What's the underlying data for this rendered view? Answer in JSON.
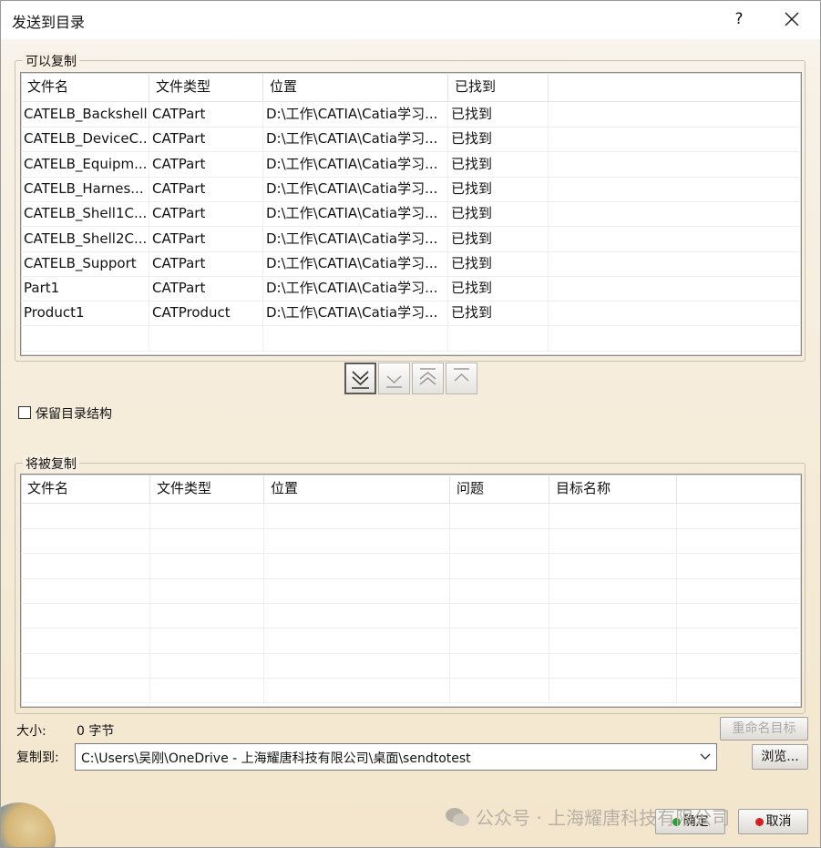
{
  "window": {
    "title": "发送到目录",
    "help_label": "?"
  },
  "copyable": {
    "label": "可以复制",
    "columns": [
      "文件名",
      "文件类型",
      "位置",
      "已找到"
    ],
    "rows": [
      [
        "CATELB_Backshell",
        "CATPart",
        "D:\\工作\\CATIA\\Catia学习...",
        "已找到"
      ],
      [
        "CATELB_DeviceC...",
        "CATPart",
        "D:\\工作\\CATIA\\Catia学习...",
        "已找到"
      ],
      [
        "CATELB_Equipm...",
        "CATPart",
        "D:\\工作\\CATIA\\Catia学习...",
        "已找到"
      ],
      [
        "CATELB_Harnes...",
        "CATPart",
        "D:\\工作\\CATIA\\Catia学习...",
        "已找到"
      ],
      [
        "CATELB_Shell1C...",
        "CATPart",
        "D:\\工作\\CATIA\\Catia学习...",
        "已找到"
      ],
      [
        "CATELB_Shell2C...",
        "CATPart",
        "D:\\工作\\CATIA\\Catia学习...",
        "已找到"
      ],
      [
        "CATELB_Support",
        "CATPart",
        "D:\\工作\\CATIA\\Catia学习...",
        "已找到"
      ],
      [
        "Part1",
        "CATPart",
        "D:\\工作\\CATIA\\Catia学习...",
        "已找到"
      ],
      [
        "Product1",
        "CATProduct",
        "D:\\工作\\CATIA\\Catia学习...",
        "已找到"
      ]
    ]
  },
  "move_buttons": [
    {
      "name": "move-all-down",
      "icon": "double-chevron-down-icon"
    },
    {
      "name": "move-down",
      "icon": "chevron-down-icon"
    },
    {
      "name": "move-up",
      "icon": "double-chevron-up-icon"
    },
    {
      "name": "move-all-up",
      "icon": "chevron-up-icon"
    }
  ],
  "keep_structure": {
    "label": "保留目录结构",
    "checked": false
  },
  "to_copy": {
    "label": "将被复制",
    "columns": [
      "文件名",
      "文件类型",
      "位置",
      "问题",
      "目标名称"
    ],
    "rows": []
  },
  "size": {
    "label": "大小:",
    "value": "0 字节"
  },
  "copy_to": {
    "label": "复制到:",
    "path": "C:\\Users\\吴刚\\OneDrive - 上海耀唐科技有限公司\\桌面\\sendtotest"
  },
  "buttons": {
    "rename": "重命名目标",
    "browse": "浏览...",
    "ok": "确定",
    "cancel": "取消"
  },
  "watermark": "公众号 · 上海耀唐科技有限公司",
  "colors": {
    "ok_dot": "#2e9a3a",
    "cancel_dot": "#d42020"
  }
}
